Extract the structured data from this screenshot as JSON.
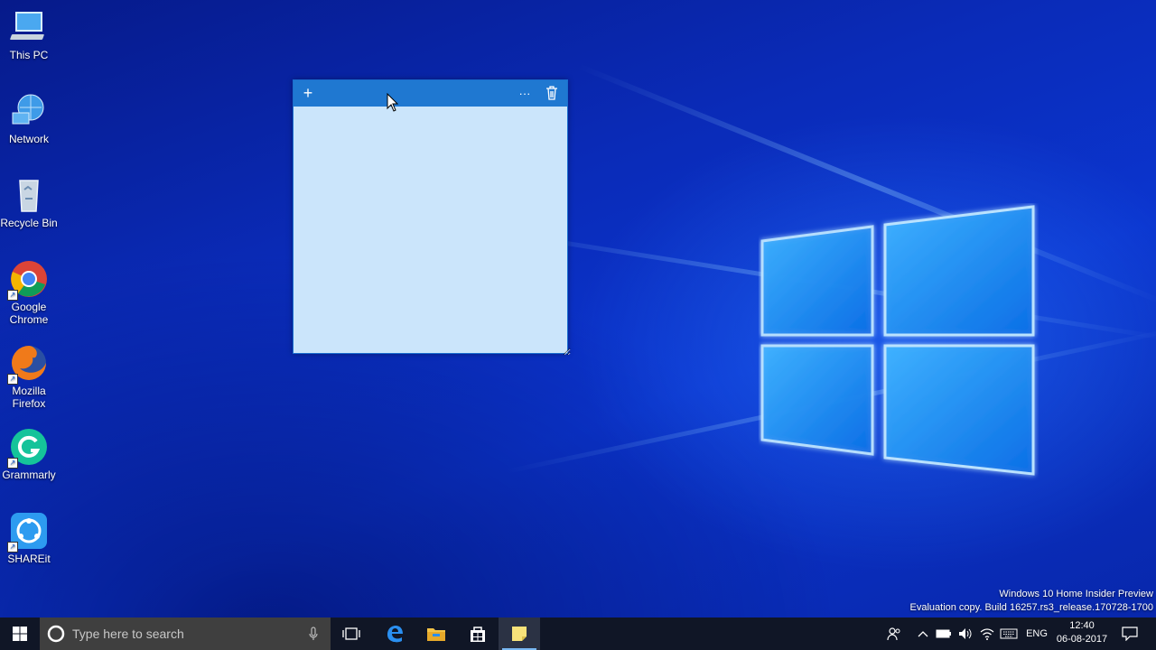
{
  "desktop": {
    "icons": [
      {
        "label_line1": "This PC",
        "label_line2": "",
        "icon": "computer-icon"
      },
      {
        "label_line1": "Network",
        "label_line2": "",
        "icon": "network-icon"
      },
      {
        "label_line1": "Recycle Bin",
        "label_line2": "",
        "icon": "recycle-bin-icon"
      },
      {
        "label_line1": "Google",
        "label_line2": "Chrome",
        "icon": "chrome-icon"
      },
      {
        "label_line1": "Mozilla",
        "label_line2": "Firefox",
        "icon": "firefox-icon"
      },
      {
        "label_line1": "Grammarly",
        "label_line2": "",
        "icon": "grammarly-icon"
      },
      {
        "label_line1": "SHAREit",
        "label_line2": "",
        "icon": "shareit-icon"
      }
    ]
  },
  "sticky_note": {
    "add_glyph": "+",
    "menu_glyph": "···",
    "delete_icon": "trash-icon",
    "content": "",
    "bar_color": "#1f78d1",
    "body_color": "#cbe5fb"
  },
  "watermark": {
    "line1": "Windows 10 Home Insider Preview",
    "line2": "Evaluation copy. Build 16257.rs3_release.170728-1700"
  },
  "taskbar": {
    "search_placeholder": "Type here to search",
    "language": "ENG",
    "time": "12:40",
    "date": "06-08-2017",
    "pinned": [
      "task-view-icon",
      "edge-icon",
      "file-explorer-icon",
      "store-icon",
      "sticky-notes-icon"
    ]
  },
  "colors": {
    "accent": "#1f78d1",
    "taskbar": "#101626"
  }
}
